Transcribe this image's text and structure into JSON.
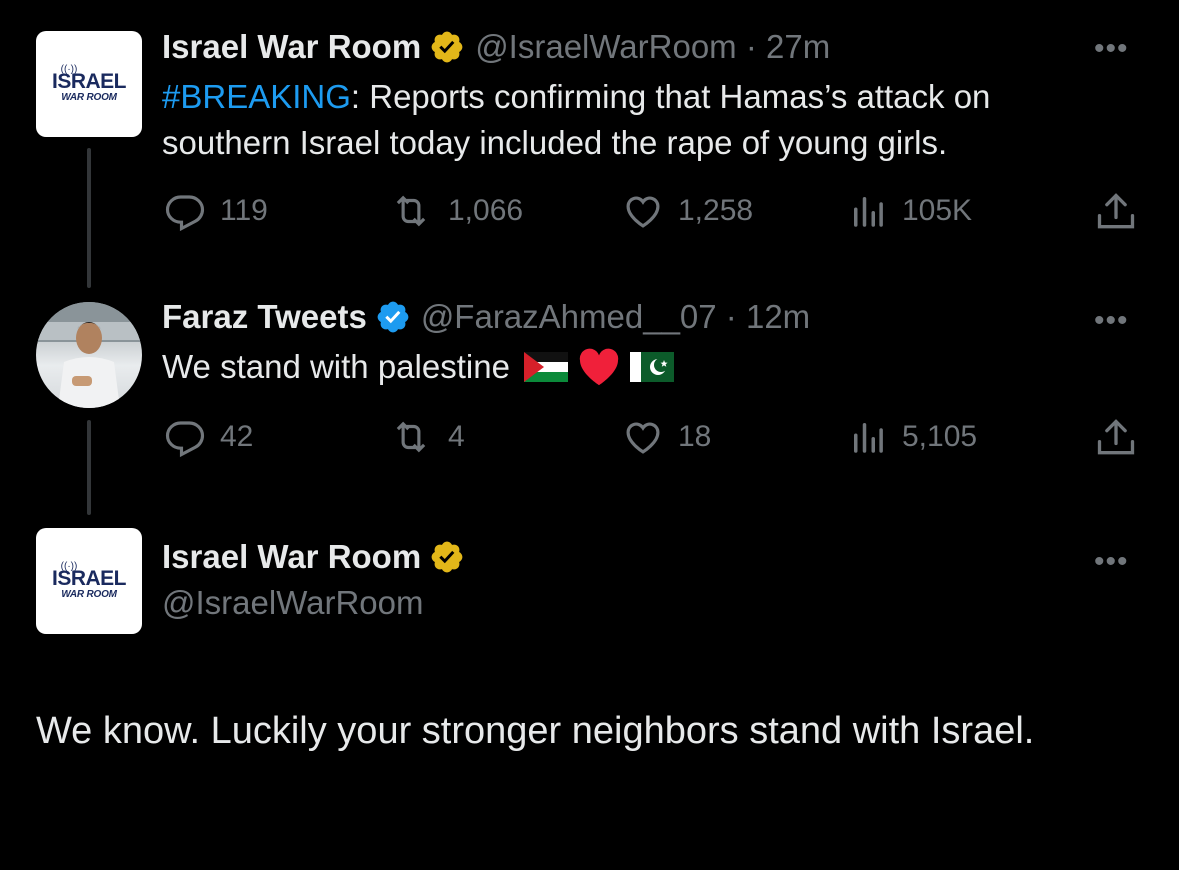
{
  "tweet1": {
    "name": "Israel War Room",
    "handle_time": "@IsraelWarRoom · 27m",
    "hashtag": "#BREAKING",
    "text": ": Reports confirming that Hamas’s attack on southern Israel today included the rape of young girls.",
    "logo_top": "ISRAEL",
    "logo_bottom": "WAR ROOM",
    "replies": "119",
    "retweets": "1,066",
    "likes": "1,258",
    "views": "105K",
    "badge_color": "#e2b719"
  },
  "tweet2": {
    "name": "Faraz Tweets",
    "handle_time": "@FarazAhmed__07 · 12m",
    "text": "We stand with palestine",
    "replies": "42",
    "retweets": "4",
    "likes": "18",
    "views": "5,105",
    "badge_color": "#1d9bf0"
  },
  "tweet3": {
    "name": "Israel War Room",
    "handle": "@IsraelWarRoom",
    "logo_top": "ISRAEL",
    "logo_bottom": "WAR ROOM",
    "text": "We know. Luckily your stronger neighbors stand with Israel.",
    "badge_color": "#e2b719"
  },
  "more_label": "•••",
  "icons": [
    "reply-icon",
    "retweet-icon",
    "like-icon",
    "views-icon",
    "share-icon",
    "more-icon",
    "verified-badge-icon"
  ]
}
